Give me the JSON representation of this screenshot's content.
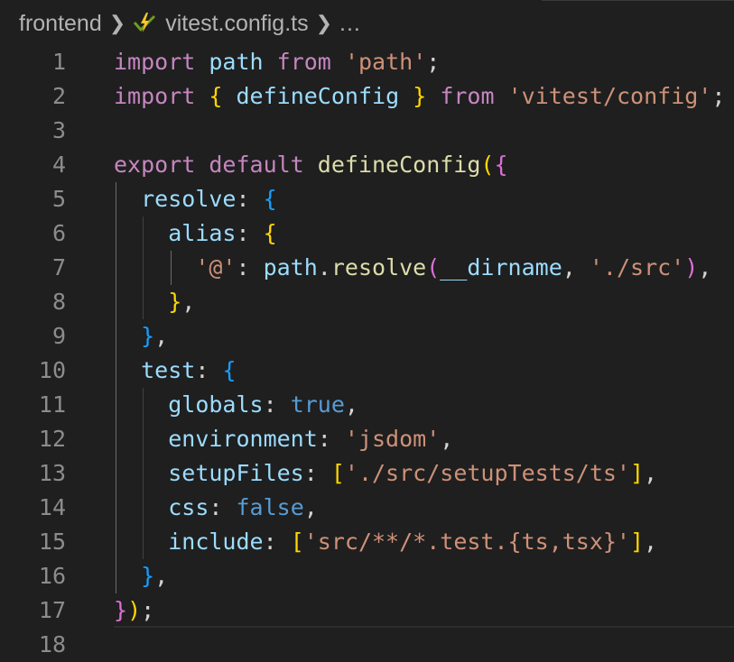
{
  "breadcrumb": {
    "folder": "frontend",
    "file": "vitest.config.ts",
    "ellipsis": "...",
    "file_icon": "vitest-bolt-icon",
    "chevron_icon": "chevron-right-icon"
  },
  "colors": {
    "background": "#1f1f1f",
    "keyword": "#c586c0",
    "variable": "#9cdcfe",
    "string": "#ce9178",
    "function": "#dcdcaa",
    "boolean": "#569cd6",
    "punctuation": "#d4d4d4",
    "bracket_level1": "#ffd700",
    "bracket_level2": "#da70d6",
    "bracket_level3": "#179fff",
    "line_number": "#8c8c8c"
  },
  "editor": {
    "line_numbers": [
      "1",
      "2",
      "3",
      "4",
      "5",
      "6",
      "7",
      "8",
      "9",
      "10",
      "11",
      "12",
      "13",
      "14",
      "15",
      "16",
      "17",
      "18"
    ],
    "lines": [
      [
        [
          "kw",
          "import"
        ],
        [
          "pn",
          " "
        ],
        [
          "id",
          "path"
        ],
        [
          "pn",
          " "
        ],
        [
          "kw",
          "from"
        ],
        [
          "pn",
          " "
        ],
        [
          "str",
          "'path'"
        ],
        [
          "pn",
          ";"
        ]
      ],
      [
        [
          "kw",
          "import"
        ],
        [
          "pn",
          " "
        ],
        [
          "b1",
          "{"
        ],
        [
          "pn",
          " "
        ],
        [
          "id",
          "defineConfig"
        ],
        [
          "pn",
          " "
        ],
        [
          "b1",
          "}"
        ],
        [
          "pn",
          " "
        ],
        [
          "kw",
          "from"
        ],
        [
          "pn",
          " "
        ],
        [
          "str",
          "'vitest/config'"
        ],
        [
          "pn",
          ";"
        ]
      ],
      [],
      [
        [
          "kw",
          "export"
        ],
        [
          "pn",
          " "
        ],
        [
          "kw",
          "default"
        ],
        [
          "pn",
          " "
        ],
        [
          "fn",
          "defineConfig"
        ],
        [
          "b1",
          "("
        ],
        [
          "b2",
          "{"
        ]
      ],
      [
        [
          "pn",
          "  "
        ],
        [
          "id",
          "resolve"
        ],
        [
          "pn",
          ": "
        ],
        [
          "b3",
          "{"
        ]
      ],
      [
        [
          "pn",
          "    "
        ],
        [
          "id",
          "alias"
        ],
        [
          "pn",
          ": "
        ],
        [
          "b1",
          "{"
        ]
      ],
      [
        [
          "pn",
          "      "
        ],
        [
          "str",
          "'@'"
        ],
        [
          "pn",
          ": "
        ],
        [
          "id",
          "path"
        ],
        [
          "pn",
          "."
        ],
        [
          "fn",
          "resolve"
        ],
        [
          "b2",
          "("
        ],
        [
          "id",
          "__dirname"
        ],
        [
          "pn",
          ", "
        ],
        [
          "str",
          "'./src'"
        ],
        [
          "b2",
          ")"
        ],
        [
          "pn",
          ","
        ]
      ],
      [
        [
          "pn",
          "    "
        ],
        [
          "b1",
          "}"
        ],
        [
          "pn",
          ","
        ]
      ],
      [
        [
          "pn",
          "  "
        ],
        [
          "b3",
          "}"
        ],
        [
          "pn",
          ","
        ]
      ],
      [
        [
          "pn",
          "  "
        ],
        [
          "id",
          "test"
        ],
        [
          "pn",
          ": "
        ],
        [
          "b3",
          "{"
        ]
      ],
      [
        [
          "pn",
          "    "
        ],
        [
          "id",
          "globals"
        ],
        [
          "pn",
          ": "
        ],
        [
          "bool",
          "true"
        ],
        [
          "pn",
          ","
        ]
      ],
      [
        [
          "pn",
          "    "
        ],
        [
          "id",
          "environment"
        ],
        [
          "pn",
          ": "
        ],
        [
          "str",
          "'jsdom'"
        ],
        [
          "pn",
          ","
        ]
      ],
      [
        [
          "pn",
          "    "
        ],
        [
          "id",
          "setupFiles"
        ],
        [
          "pn",
          ": "
        ],
        [
          "b1",
          "["
        ],
        [
          "str",
          "'./src/setupTests/ts'"
        ],
        [
          "b1",
          "]"
        ],
        [
          "pn",
          ","
        ]
      ],
      [
        [
          "pn",
          "    "
        ],
        [
          "id",
          "css"
        ],
        [
          "pn",
          ": "
        ],
        [
          "bool",
          "false"
        ],
        [
          "pn",
          ","
        ]
      ],
      [
        [
          "pn",
          "    "
        ],
        [
          "id",
          "include"
        ],
        [
          "pn",
          ": "
        ],
        [
          "b1",
          "["
        ],
        [
          "str",
          "'src/**/*.test.{ts,tsx}'"
        ],
        [
          "b1",
          "]"
        ],
        [
          "pn",
          ","
        ]
      ],
      [
        [
          "pn",
          "  "
        ],
        [
          "b3",
          "}"
        ],
        [
          "pn",
          ","
        ]
      ],
      [
        [
          "b2",
          "}"
        ],
        [
          "b1",
          ")"
        ],
        [
          "pn",
          ";"
        ]
      ],
      []
    ]
  }
}
